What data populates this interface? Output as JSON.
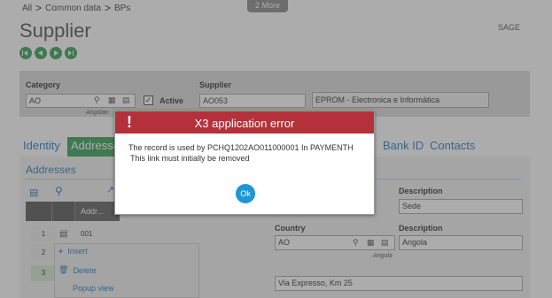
{
  "breadcrumb": {
    "items": [
      "All",
      "Common data",
      "BPs"
    ],
    "separator": ">"
  },
  "more_tab": "2 More",
  "page": {
    "title": "Supplier",
    "company": "SAGE"
  },
  "nav_icons": [
    "first-record-icon",
    "previous-record-icon",
    "next-record-icon",
    "last-record-icon"
  ],
  "header": {
    "category": {
      "label": "Category",
      "value": "AO",
      "sub_label": "Angolan"
    },
    "active": {
      "label": "Active",
      "checked": true
    },
    "supplier": {
      "label": "Supplier",
      "value": "AO053",
      "name": "EPROM - Electronica e Informática"
    }
  },
  "tabs": [
    "Identity",
    "Addresses",
    "Bank ID",
    "Contacts"
  ],
  "active_tab": "Addresses",
  "section": {
    "title": "Addresses"
  },
  "grid": {
    "column": "Addr...",
    "rows": [
      {
        "num": "1",
        "code": "001"
      },
      {
        "num": "2",
        "code": ""
      },
      {
        "num": "3",
        "code": ""
      }
    ]
  },
  "context_menu": {
    "insert": "Insert",
    "delete": "Delete",
    "popup": "Popup view"
  },
  "detail": {
    "desc_label_1": "Description",
    "desc_value_1": "Sede",
    "country_label": "Country",
    "country_value": "AO",
    "country_sub": "Angola",
    "desc_label_2": "Description",
    "desc_value_2": "Angola",
    "address_line": "Via Expresso, Km 25"
  },
  "dialog": {
    "title": "X3 application error",
    "line1": "The record is used by PCHQ1202AO011000001 In PAYMENTH",
    "line2": "This link must initially be removed",
    "ok": "Ok"
  },
  "colors": {
    "accent_green": "#3aa35a",
    "error_red": "#b4313c",
    "ok_blue": "#1f96d6",
    "link_blue": "#2a7fc0"
  }
}
